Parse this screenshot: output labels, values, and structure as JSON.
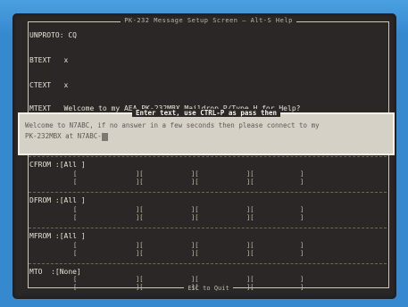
{
  "window": {
    "title": "PK-232 Message Setup Screen — Alt-S Help",
    "footer": "ESC to Quit"
  },
  "fields": [
    {
      "label": "UNPROTO",
      "value": "CQ"
    },
    {
      "label": "BTEXT",
      "value": "x"
    },
    {
      "label": "CTEXT",
      "value": "x"
    },
    {
      "label": "MTEXT",
      "value": "Welcome to my AEA PK-232MBX Maildrop.P/Type H for Help?"
    }
  ],
  "prompt": {
    "title": "Enter text, use CTRL-P as pass then",
    "line1": "Welcome to N7ABC, if no answer in a few seconds then please connect to my",
    "line2": "PK-232MBX at N7ABC-"
  },
  "lists": [
    {
      "label": "CFROM",
      "first": "[All ]"
    },
    {
      "label": "DFROM",
      "first": "[All ]"
    },
    {
      "label": "MFROM",
      "first": "[All ]"
    },
    {
      "label": "MTO",
      "first": "[None]"
    }
  ],
  "cell_marks": {
    "open": "[",
    "mid": "][",
    "close": "]"
  }
}
